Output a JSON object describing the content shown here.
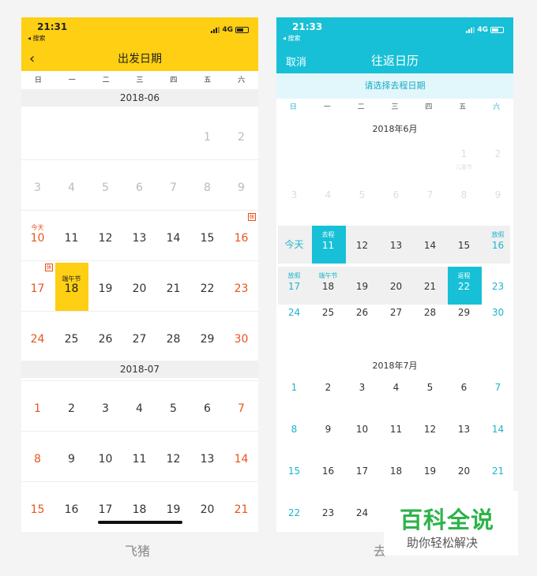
{
  "left": {
    "time": "21:31",
    "back_label": "◂ 搜索",
    "network": "4G",
    "title": "出发日期",
    "weekdays": [
      "日",
      "一",
      "二",
      "三",
      "四",
      "五",
      "六"
    ],
    "months": [
      {
        "label": "2018-06",
        "weeks": [
          [
            "",
            "",
            "",
            "",
            "",
            "1",
            "2"
          ],
          [
            "3",
            "4",
            "5",
            "6",
            "7",
            "8",
            "9"
          ],
          [
            "10",
            "11",
            "12",
            "13",
            "14",
            "15",
            "16"
          ],
          [
            "17",
            "18",
            "19",
            "20",
            "21",
            "22",
            "23"
          ],
          [
            "24",
            "25",
            "26",
            "27",
            "28",
            "29",
            "30"
          ]
        ]
      },
      {
        "label": "2018-07",
        "weeks": [
          [
            "1",
            "2",
            "3",
            "4",
            "5",
            "6",
            "7"
          ],
          [
            "8",
            "9",
            "10",
            "11",
            "12",
            "13",
            "14"
          ],
          [
            "15",
            "16",
            "17",
            "18",
            "19",
            "20",
            "21"
          ]
        ]
      }
    ],
    "today_label": "今天",
    "festival_label": "端午节",
    "holiday_tag": "休",
    "highlight_color": "#fecf13",
    "caption": "飞猪"
  },
  "right": {
    "time": "21:33",
    "back_label": "◂ 搜索",
    "network": "4G",
    "title": "往返日历",
    "cancel": "取消",
    "subtitle": "请选择去程日期",
    "weekdays": [
      "日",
      "一",
      "二",
      "三",
      "四",
      "五",
      "六"
    ],
    "months": [
      {
        "label": "2018年6月",
        "weeks": [
          [
            "",
            "",
            "",
            "",
            "",
            "1",
            "2"
          ],
          [
            "3",
            "4",
            "5",
            "6",
            "7",
            "8",
            "9"
          ],
          [
            "今天",
            "11",
            "12",
            "13",
            "14",
            "15",
            "16"
          ],
          [
            "17",
            "18",
            "19",
            "20",
            "21",
            "22",
            "23"
          ],
          [
            "24",
            "25",
            "26",
            "27",
            "28",
            "29",
            "30"
          ]
        ]
      },
      {
        "label": "2018年7月",
        "weeks": [
          [
            "1",
            "2",
            "3",
            "4",
            "5",
            "6",
            "7"
          ],
          [
            "8",
            "9",
            "10",
            "11",
            "12",
            "13",
            "14"
          ],
          [
            "15",
            "16",
            "17",
            "18",
            "19",
            "20",
            "21"
          ],
          [
            "22",
            "23",
            "24",
            "",
            "",
            "",
            ""
          ]
        ]
      }
    ],
    "children_day": "儿童节",
    "depart_label": "去程",
    "return_label": "返程",
    "holiday_label": "放假",
    "festival_label": "端午节",
    "accent_color": "#17c0d6",
    "caption": "去"
  },
  "watermark": {
    "title": "百科全说",
    "subtitle": "助你轻松解决"
  }
}
